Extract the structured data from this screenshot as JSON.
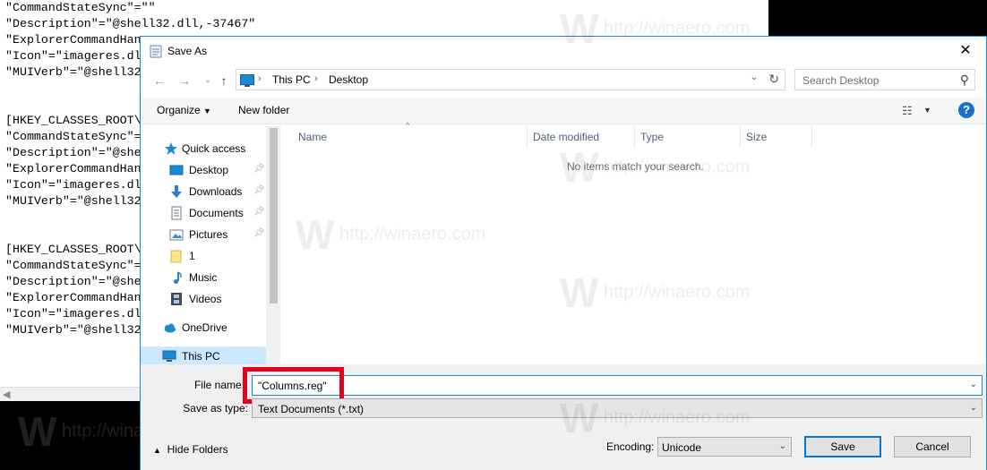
{
  "notepad": {
    "lines": [
      "\"CommandStateSync\"=\"\"",
      "\"Description\"=\"@shell32.dll,-37467\"",
      "\"ExplorerCommandHan",
      "\"Icon\"=\"imageres.dl",
      "\"MUIVerb\"=\"@shell32",
      "",
      "",
      "[HKEY_CLASSES_ROOT\\",
      "\"CommandStateSync\"=",
      "\"Description\"=\"@she",
      "\"ExplorerCommandHan",
      "\"Icon\"=\"imageres.dl",
      "\"MUIVerb\"=\"@shell32",
      "",
      "",
      "[HKEY_CLASSES_ROOT\\",
      "\"CommandStateSync\"=",
      "\"Description\"=\"@she",
      "\"ExplorerCommandHan",
      "\"Icon\"=\"imageres.dl",
      "\"MUIVerb\"=\"@shell32"
    ]
  },
  "dialog": {
    "title": "Save As",
    "close_glyph": "✕",
    "icon": "notepad-doc-icon"
  },
  "address": {
    "crumbs": [
      "This PC",
      "Desktop"
    ],
    "search_placeholder": "Search Desktop"
  },
  "toolbar": {
    "organize_label": "Organize",
    "new_folder_label": "New folder"
  },
  "navpane": {
    "quick_access": "Quick access",
    "items": [
      {
        "label": "Desktop",
        "pinned": true
      },
      {
        "label": "Downloads",
        "pinned": true
      },
      {
        "label": "Documents",
        "pinned": true
      },
      {
        "label": "Pictures",
        "pinned": true
      },
      {
        "label": "1",
        "pinned": false
      },
      {
        "label": "Music",
        "pinned": false
      },
      {
        "label": "Videos",
        "pinned": false
      }
    ],
    "onedrive": "OneDrive",
    "this_pc": "This PC"
  },
  "filelist": {
    "columns": [
      "Name",
      "Date modified",
      "Type",
      "Size"
    ],
    "empty_message": "No items match your search."
  },
  "form": {
    "file_name_label": "File name:",
    "file_name_value": "\"Columns.reg\"",
    "save_as_type_label": "Save as type:",
    "save_as_type_value": "Text Documents (*.txt)",
    "encoding_label": "Encoding:",
    "encoding_value": "Unicode",
    "hide_folders_label": "Hide Folders",
    "save_label": "Save",
    "cancel_label": "Cancel"
  },
  "watermark": "http://winaero.com",
  "colors": {
    "accent": "#0078d7",
    "highlight_box": "#e5001b",
    "selected_nav": "#cce8ff"
  }
}
